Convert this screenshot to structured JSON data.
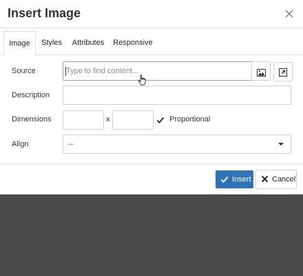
{
  "dialog": {
    "title": "Insert Image"
  },
  "tabs": [
    {
      "label": "Image",
      "active": true
    },
    {
      "label": "Styles",
      "active": false
    },
    {
      "label": "Attributes",
      "active": false
    },
    {
      "label": "Responsive",
      "active": false
    }
  ],
  "form": {
    "source": {
      "label": "Source",
      "placeholder": "Type to find content...",
      "value": ""
    },
    "description": {
      "label": "Description",
      "value": ""
    },
    "dimensions": {
      "label": "Dimensions",
      "width": "",
      "height": "",
      "separator": "x",
      "proportional_label": "Proportional",
      "proportional_checked": true
    },
    "align": {
      "label": "Align",
      "selected": "--"
    }
  },
  "footer": {
    "insert_label": "Insert",
    "cancel_label": "Cancel"
  },
  "colors": {
    "primary": "#2f73b8",
    "overlay": "#4a4a4a"
  },
  "icons": [
    "close-icon",
    "cloud-upload-icon",
    "image-browse-icon",
    "popout-icon",
    "checkmark-icon",
    "x-icon",
    "hand-pointer-cursor"
  ]
}
